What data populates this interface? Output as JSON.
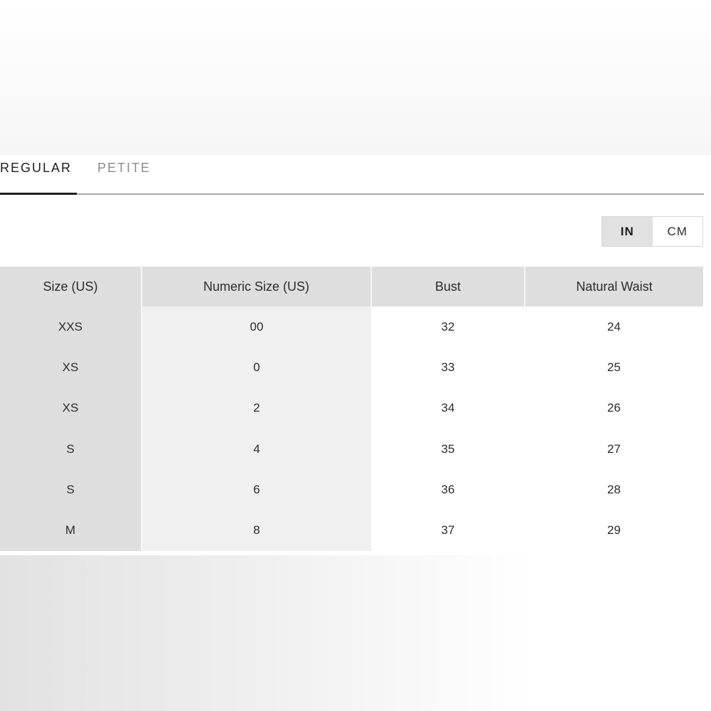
{
  "tabs": [
    {
      "label": "REGULAR",
      "active": true
    },
    {
      "label": "PETITE",
      "active": false
    }
  ],
  "units": {
    "options": [
      "IN",
      "CM"
    ],
    "selected": "IN"
  },
  "table": {
    "headers": [
      "Size (US)",
      "Numeric Size (US)",
      "Bust",
      "Natural Waist"
    ],
    "rows": [
      [
        "XXS",
        "00",
        "32",
        "24"
      ],
      [
        "XS",
        "0",
        "33",
        "25"
      ],
      [
        "XS",
        "2",
        "34",
        "26"
      ],
      [
        "S",
        "4",
        "35",
        "27"
      ],
      [
        "S",
        "6",
        "36",
        "28"
      ],
      [
        "M",
        "8",
        "37",
        "29"
      ]
    ]
  }
}
